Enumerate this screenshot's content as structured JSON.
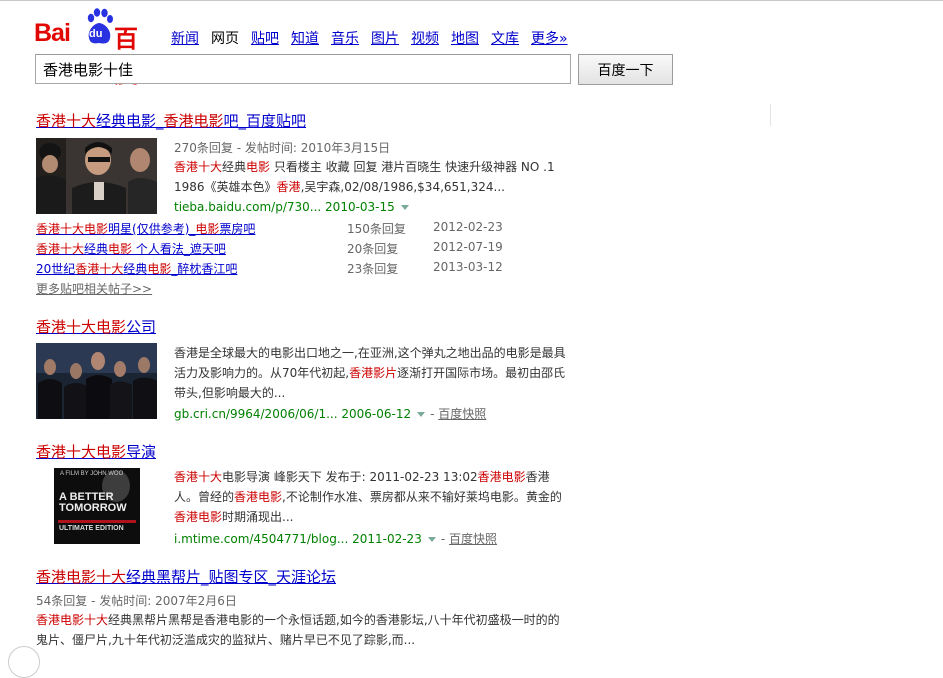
{
  "logo": {
    "latin": "Bai",
    "badge": "du",
    "chinese": "百度"
  },
  "nav": [
    "新闻",
    "网页",
    "贴吧",
    "知道",
    "音乐",
    "图片",
    "视频",
    "地图",
    "文库",
    "更多»"
  ],
  "search": {
    "value": "香港电影十佳",
    "button": "百度一下"
  },
  "results": [
    {
      "title_parts": [
        "香港十大",
        "经典电影",
        "_",
        "香港电影",
        "吧_百度贴吧"
      ],
      "meta": "270条回复 - 发帖时间: 2010年3月15日",
      "snippet_parts": [
        "香港十大",
        "经典",
        "电影",
        " 只看楼主 收藏 回复 港片百晓生 快速升级神器 NO .1 1986《英雄本色》",
        "香港",
        ",吴宇森,02/08/1986,$34,651,324..."
      ],
      "url": "tieba.baidu.com/p/730... 2010-03-15",
      "sub_results": [
        {
          "title_parts": [
            "香港十大电影",
            "明星(仅供参考)_",
            "电影",
            "票房吧"
          ],
          "count": "150条回复",
          "date": "2012-02-23"
        },
        {
          "title_parts": [
            "香港十大",
            "经典",
            "电影",
            " 个人看法_遮天吧"
          ],
          "count": "20条回复",
          "date": "2012-07-19"
        },
        {
          "title_parts": [
            "20世纪",
            "香港十大",
            "经典",
            "电影",
            "_醉枕香江吧"
          ],
          "count": "23条回复",
          "date": "2013-03-12"
        }
      ],
      "more": "更多贴吧相关帖子>>"
    },
    {
      "title_parts": [
        "香港十大电影",
        "公司"
      ],
      "snippet_parts": [
        "香港是全球最大的电影出口地之一,在亚洲,这个弹丸之地出品的电影是最具活力及影响力的。从70年代初起,",
        "香港影片",
        "逐渐打开国际市场。最初由邵氏带头,但影响最大的..."
      ],
      "url": "gb.cri.cn/9964/2006/06/1... 2006-06-12",
      "cache": "百度快照"
    },
    {
      "title_parts": [
        "香港十大电影",
        "导演"
      ],
      "snippet_parts": [
        "香港十大",
        "电影导演 峰影天下 发布于: 2011-02-23 13:02",
        "香港电影",
        "香港人。曾经的",
        "香港电影",
        ",不论制作水准、票房都从来不输好莱坞电影。黄金的",
        "香港电影",
        "时期涌现出..."
      ],
      "url": "i.mtime.com/4504771/blog... 2011-02-23",
      "cache": "百度快照",
      "poster": {
        "byline": "A FILM BY JOHN WOO",
        "title_line1": "A BETTER",
        "title_line2": "TOMORROW",
        "edition": "ULTIMATE EDITION"
      }
    },
    {
      "title_parts": [
        "香港电影十大",
        "经典黑帮片_贴图专区_天涯论坛"
      ],
      "meta": "54条回复 - 发帖时间: 2007年2月6日",
      "snippet_parts": [
        "香港电影十大",
        "经典黑帮片黑帮是香港电影的一个永恒话题,如今的香港影坛,八十年代初盛极一时的的鬼片、僵尸片,九十年代初泛滥成灾的监狱片、赌片早已不见了踪影,而..."
      ]
    }
  ],
  "colors": {
    "link": "#0000cc",
    "highlight": "#cc0000",
    "url": "#008000",
    "brand": "#e10602"
  }
}
